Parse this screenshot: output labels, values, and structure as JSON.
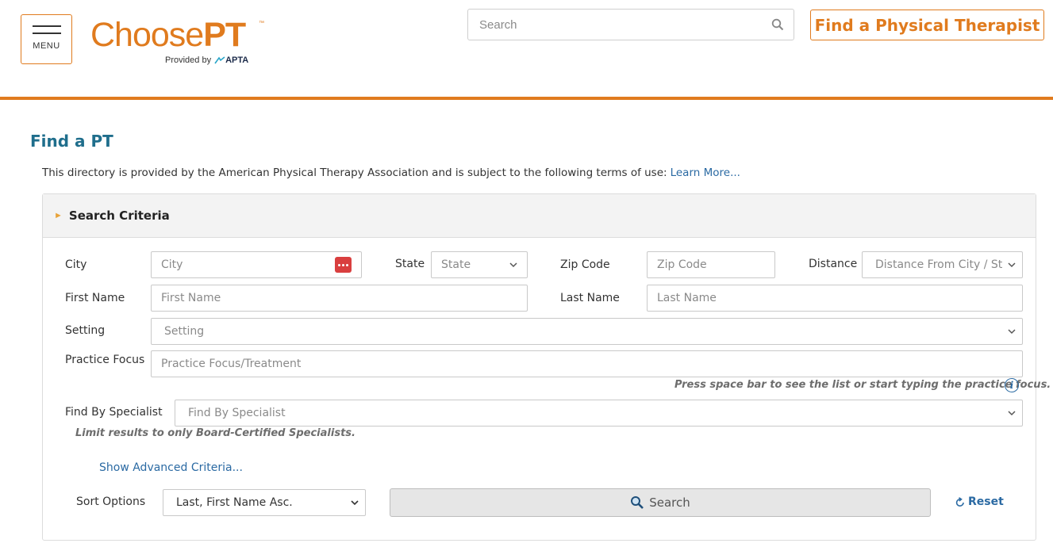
{
  "header": {
    "menu_label": "MENU",
    "logo_choose": "Choose",
    "logo_pt": "PT",
    "logo_tm": "™",
    "logo_provided_by": "Provided by",
    "logo_apta": "APTA",
    "search_placeholder": "Search",
    "find_pt_button": "Find a Physical Therapist",
    "accent_color": "#e07b1e"
  },
  "main": {
    "title": "Find a PT",
    "terms_text": "This directory is provided by the American Physical Therapy Association and is subject to the following terms of use:",
    "terms_link": "Learn More..."
  },
  "search_criteria": {
    "title": "Search Criteria",
    "city": {
      "label": "City",
      "placeholder": "City"
    },
    "state": {
      "label": "State",
      "value": "State"
    },
    "zip": {
      "label": "Zip Code",
      "placeholder": "Zip Code"
    },
    "distance": {
      "label": "Distance",
      "value": "Distance From City / State"
    },
    "first_name": {
      "label": "First Name",
      "placeholder": "First Name"
    },
    "last_name": {
      "label": "Last Name",
      "placeholder": "Last Name"
    },
    "setting": {
      "label": "Setting",
      "value": "Setting"
    },
    "practice_focus": {
      "label": "Practice Focus",
      "placeholder": "Practice Focus/Treatment",
      "hint": "Press space bar to see the list or start typing the practice focus."
    },
    "specialist": {
      "label": "Find By Specialist",
      "value": "Find By Specialist",
      "hint": "Limit results to only Board-Certified Specialists."
    },
    "advanced_link": "Show Advanced Criteria...",
    "sort": {
      "label": "Sort Options",
      "value": "Last, First Name Asc."
    },
    "search_button": "Search",
    "reset_link": "Reset"
  }
}
